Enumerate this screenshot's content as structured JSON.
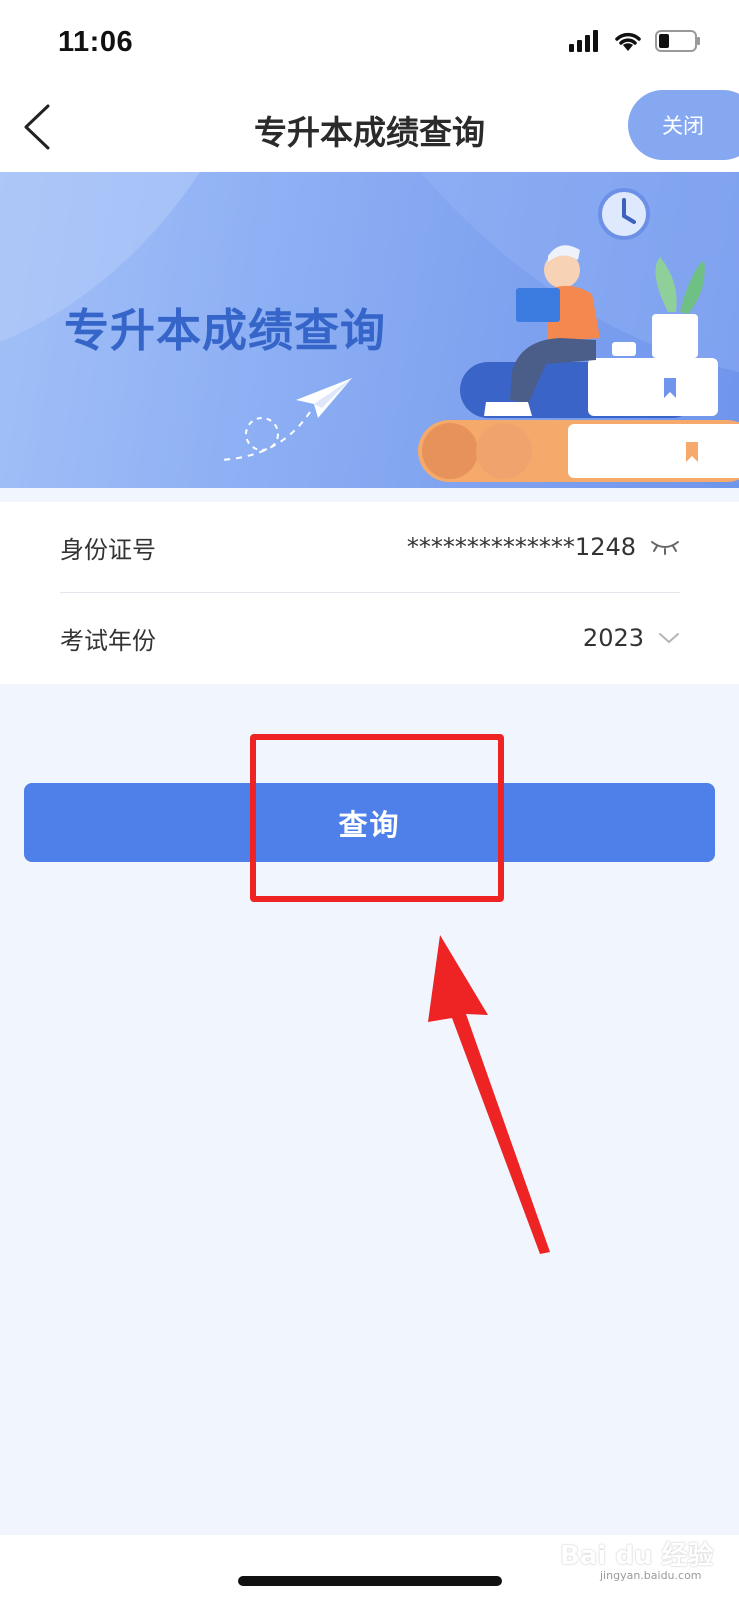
{
  "status_bar": {
    "time": "11:06"
  },
  "nav": {
    "title": "专升本成绩查询",
    "close_label": "关闭"
  },
  "banner": {
    "title": "专升本成绩查询"
  },
  "form": {
    "id_label": "身份证号",
    "id_value": "**************1248",
    "year_label": "考试年份",
    "year_value": "2023"
  },
  "query_button": {
    "label": "查询"
  },
  "watermark": {
    "text": "Bai du 经验",
    "sub": "jingyan.baidu.com"
  },
  "colors": {
    "primary": "#4f7fe8",
    "close_button": "#86a8f1",
    "banner_title": "#3565c8",
    "annotation": "#ee2323",
    "page_bg": "#f1f5fd"
  }
}
